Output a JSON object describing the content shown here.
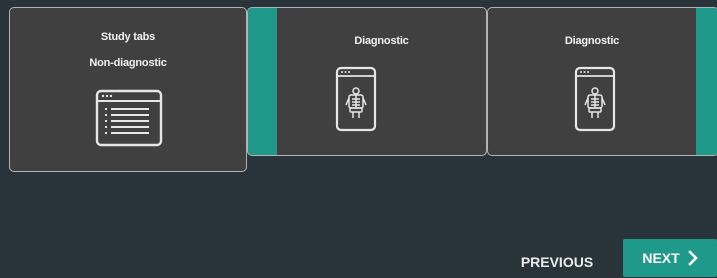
{
  "cards": [
    {
      "line1": "Study tabs",
      "line2": "Non-diagnostic",
      "icon": "study-tabs-icon"
    },
    {
      "line1": "Diagnostic",
      "icon": "diagnostic-viewer-icon"
    },
    {
      "line1": "Diagnostic",
      "icon": "diagnostic-viewer-icon"
    }
  ],
  "nav": {
    "previous_label": "PREVIOUS",
    "next_label": "NEXT",
    "next_icon": "chevron-right-icon"
  },
  "colors": {
    "background": "#29343a",
    "card": "#404040",
    "card_border": "#b3b3b3",
    "accent": "#1f9a8a"
  }
}
